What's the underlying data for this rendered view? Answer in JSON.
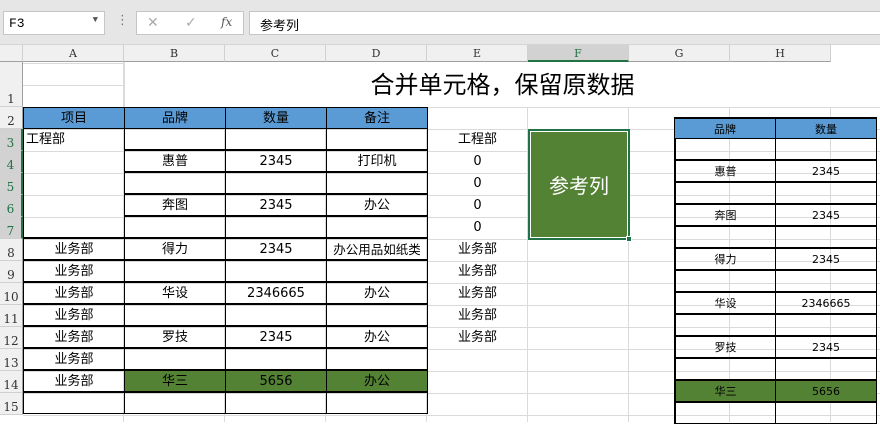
{
  "formula_bar": {
    "name_box": "F3",
    "cancel_icon": "✕",
    "enter_icon": "✓",
    "fx_label": "fx",
    "formula": "参考列"
  },
  "columns": [
    "A",
    "B",
    "C",
    "D",
    "E",
    "F",
    "G",
    "H"
  ],
  "rows": [
    "1",
    "2",
    "3",
    "4",
    "5",
    "6",
    "7",
    "8",
    "9",
    "10",
    "11",
    "12",
    "13",
    "14",
    "15"
  ],
  "title": "合并单元格，保留原数据",
  "main_table": {
    "headers": [
      "项目",
      "品牌",
      "数量",
      "备注"
    ],
    "rows": [
      [
        "工程部",
        "",
        "",
        ""
      ],
      [
        "",
        "惠普",
        "2345",
        "打印机"
      ],
      [
        "",
        "",
        "",
        ""
      ],
      [
        "",
        "奔图",
        "2345",
        "办公"
      ],
      [
        "",
        "",
        "",
        ""
      ],
      [
        "业务部",
        "得力",
        "2345",
        "办公用品如纸类"
      ],
      [
        "业务部",
        "",
        "",
        ""
      ],
      [
        "业务部",
        "华设",
        "2346665",
        "办公"
      ],
      [
        "业务部",
        "",
        "",
        ""
      ],
      [
        "业务部",
        "罗技",
        "2345",
        "办公"
      ],
      [
        "业务部",
        "",
        "",
        ""
      ],
      [
        "业务部",
        "华三",
        "5656",
        "办公"
      ],
      [
        "",
        "",
        "",
        ""
      ]
    ],
    "highlight_row": 11
  },
  "column_e": [
    "工程部",
    "0",
    "0",
    "0",
    "0",
    "业务部",
    "业务部",
    "业务部",
    "业务部",
    "业务部"
  ],
  "reference_label": "参考列",
  "right_table": {
    "headers": [
      "品牌",
      "数量"
    ],
    "rows": [
      [
        "",
        ""
      ],
      [
        "惠普",
        "2345"
      ],
      [
        "",
        ""
      ],
      [
        "奔图",
        "2345"
      ],
      [
        "",
        ""
      ],
      [
        "得力",
        "2345"
      ],
      [
        "",
        ""
      ],
      [
        "华设",
        "2346665"
      ],
      [
        "",
        ""
      ],
      [
        "罗技",
        "2345"
      ],
      [
        "",
        ""
      ],
      [
        "华三",
        "5656"
      ],
      [
        "",
        ""
      ]
    ],
    "highlight_row": 11
  },
  "colors": {
    "header_blue": "#5b9bd5",
    "green": "#548235",
    "excel_green": "#217346"
  }
}
